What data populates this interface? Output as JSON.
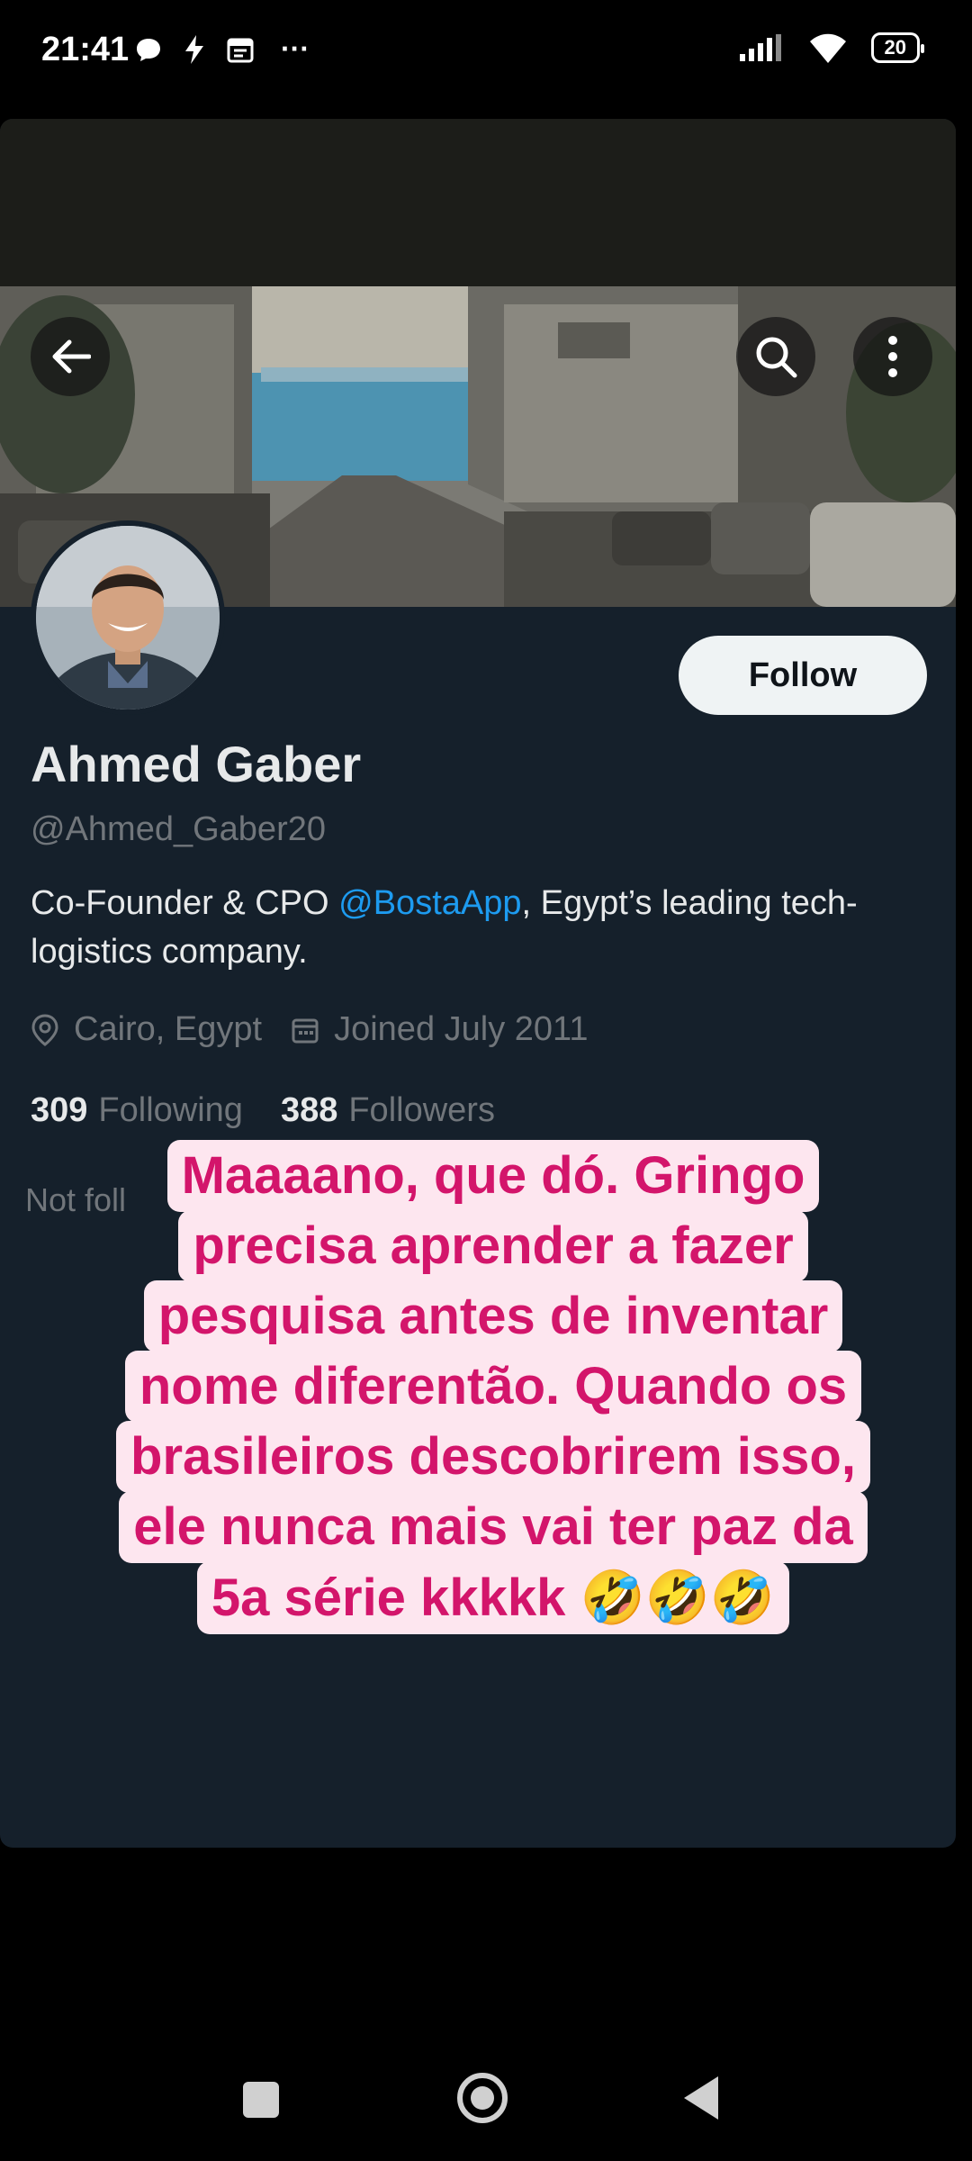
{
  "status_bar": {
    "time": "21:41",
    "more": "···",
    "battery": "20"
  },
  "profile": {
    "follow_label": "Follow",
    "name": "Ahmed Gaber",
    "handle": "@Ahmed_Gaber20",
    "bio_prefix": "Co-Founder & CPO ",
    "bio_mention": "@BostaApp",
    "bio_suffix": ", Egypt’s leading tech-logistics company.",
    "location": "Cairo, Egypt",
    "joined": "Joined July 2011",
    "following_count": "309",
    "following_label": "Following",
    "followers_count": "388",
    "followers_label": "Followers",
    "not_followed": "Not foll"
  },
  "caption": {
    "lines": [
      "Maaaano, que dó. Gringo",
      "precisa aprender a fazer",
      "pesquisa antes de inventar",
      "nome diferentão. Quando os",
      "brasileiros descobrirem isso,",
      "ele nunca mais vai ter paz da",
      "5a série kkkkk"
    ],
    "emoji": "🤣🤣🤣"
  },
  "icons": {
    "back": "back-arrow-icon",
    "search": "search-icon",
    "more": "more-vertical-icon",
    "location": "location-pin-icon",
    "calendar": "calendar-icon"
  }
}
